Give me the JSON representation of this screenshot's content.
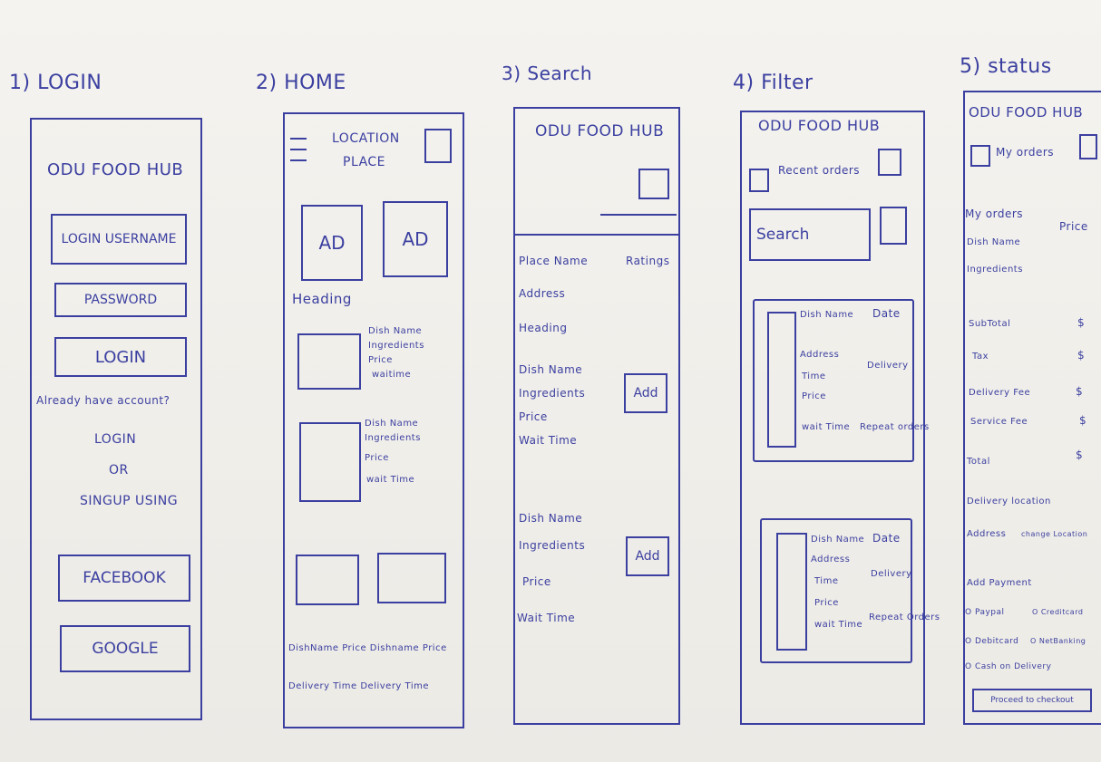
{
  "screens": {
    "login": {
      "label": "1) LOGIN",
      "app_title": "ODU FOOD HUB",
      "username_field": "LOGIN USERNAME",
      "password_field": "PASSWORD",
      "login_button": "LOGIN",
      "already_text": "Already have account?",
      "login_text": "LOGIN",
      "or_text": "OR",
      "signup_text": "SINGUP USING",
      "facebook_button": "FACEBOOK",
      "google_button": "GOOGLE"
    },
    "home": {
      "label": "2) HOME",
      "location_line1": "LOCATION",
      "location_line2": "PLACE",
      "ad1": "AD",
      "ad2": "AD",
      "heading": "Heading",
      "item1": [
        "Dish Name",
        "Ingredients",
        "Price",
        "waitime"
      ],
      "item2": [
        "Dish Name",
        "Ingredients",
        "Price",
        "wait Time"
      ],
      "footer_row1": "DishName Price Dishname Price",
      "footer_row2": "Delivery Time Delivery Time"
    },
    "search": {
      "label": "3) Search",
      "app_title": "ODU FOOD HUB",
      "place_name": "Place Name",
      "ratings": "Ratings",
      "address": "Address",
      "heading": "Heading",
      "item1": [
        "Dish Name",
        "Ingredients",
        "Price",
        "Wait Time"
      ],
      "item2": [
        "Dish Name",
        "Ingredients",
        "Price",
        "Wait Time"
      ],
      "add1": "Add",
      "add2": "Add"
    },
    "filter": {
      "label": "4) Filter",
      "app_title": "ODU FOOD HUB",
      "recent_orders": "Recent orders",
      "search_placeholder": "Search",
      "card1": {
        "left": [
          "Dish Name",
          "Address",
          "Time",
          "Price",
          "wait Time"
        ],
        "date": "Date",
        "delivery": "Delivery",
        "repeat": "Repeat orders"
      },
      "card2": {
        "left": [
          "Dish Name",
          "Address",
          "Time",
          "Price",
          "wait Time"
        ],
        "date": "Date",
        "delivery": "Delivery",
        "repeat": "Repeat Orders"
      }
    },
    "status": {
      "label": "5) status",
      "app_title": "ODU FOOD HUB",
      "my_orders_check": "My orders",
      "my_orders": "My orders",
      "price": "Price",
      "dish_name": "Dish Name",
      "ingredients": "Ingredients",
      "subtotal": "SubTotal",
      "tax": "Tax",
      "delivery_fee": "Delivery Fee",
      "service_fee": "Service Fee",
      "total": "Total",
      "dollar": "$",
      "delivery_location": "Delivery location",
      "address": "Address",
      "change_location": "change Location",
      "add_payment": "Add Payment",
      "opt_paypal": "O Paypal",
      "opt_credit": "O Creditcard",
      "opt_debit": "O Debitcard",
      "opt_netbanking": "O NetBanking",
      "opt_cash": "O Cash on Delivery",
      "proceed": "Proceed to checkout"
    }
  }
}
